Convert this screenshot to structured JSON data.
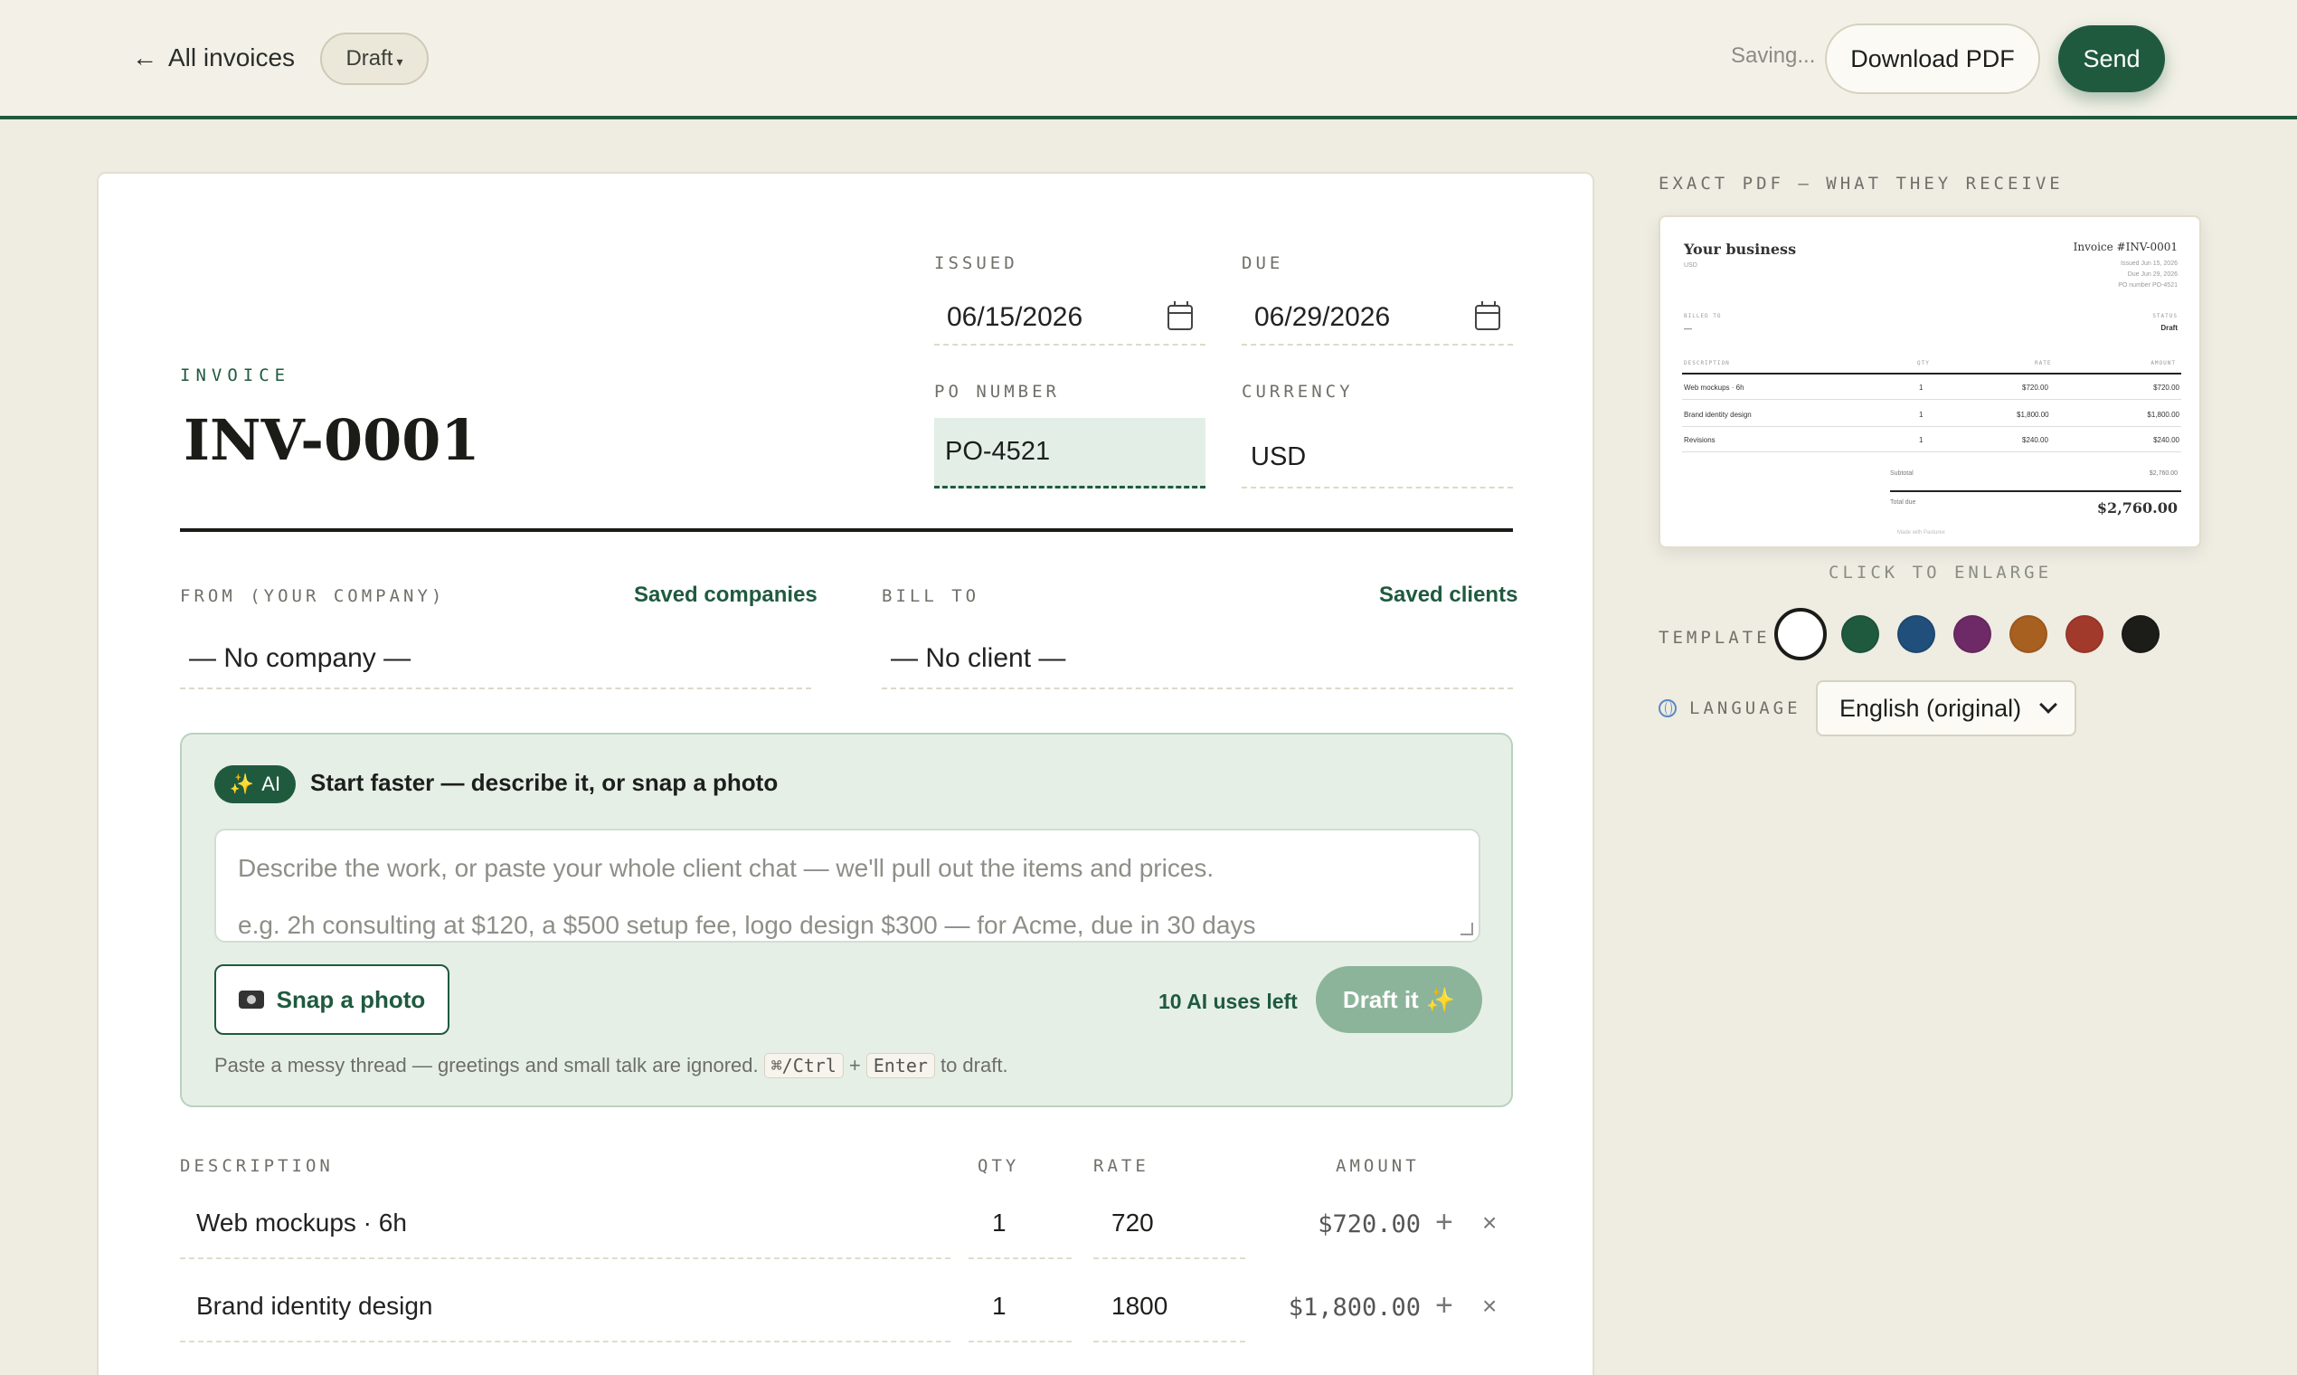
{
  "topbar": {
    "back_label": "All invoices",
    "status_label": "Draft",
    "saving_text": "Saving...",
    "download_label": "Download PDF",
    "send_label": "Send"
  },
  "invoice": {
    "heading": "INVOICE",
    "number": "INV-0001",
    "issued_label": "ISSUED",
    "issued_value": "06/15/2026",
    "due_label": "DUE",
    "due_value": "06/29/2026",
    "po_label": "PO NUMBER",
    "po_value": "PO-4521",
    "currency_label": "CURRENCY",
    "currency_value": "USD"
  },
  "parties": {
    "from_label": "FROM (YOUR COMPANY)",
    "saved_companies": "Saved companies",
    "from_value": "— No company —",
    "bill_to_label": "BILL TO",
    "saved_clients": "Saved clients",
    "bill_to_value": "— No client —"
  },
  "ai": {
    "badge": "AI",
    "title": "Start faster — describe it, or snap a photo",
    "placeholder_line1": "Describe the work, or paste your whole client chat — we'll pull out the items and prices.",
    "placeholder_line2": "e.g. 2h consulting at $120, a $500 setup fee, logo design $300 — for Acme, due in 30 days",
    "snap_label": "Snap a photo",
    "uses_left": "10 AI uses left",
    "draft_label": "Draft it",
    "hint_prefix": "Paste a messy thread — greetings and small talk are ignored.",
    "kbd_mod": "⌘/Ctrl",
    "kbd_plus": "+",
    "kbd_enter": "Enter",
    "hint_suffix": "to draft."
  },
  "items": {
    "headers": {
      "description": "DESCRIPTION",
      "qty": "QTY",
      "rate": "RATE",
      "amount": "AMOUNT"
    },
    "rows": [
      {
        "description": "Web mockups · 6h",
        "qty": "1",
        "rate": "720",
        "amount": "$720.00"
      },
      {
        "description": "Brand identity design",
        "qty": "1",
        "rate": "1800",
        "amount": "$1,800.00"
      }
    ]
  },
  "preview": {
    "label": "EXACT PDF — WHAT THEY RECEIVE",
    "business": "Your business",
    "currency": "USD",
    "invoice_no": "Invoice #INV-0001",
    "issued": "Issued Jun 15, 2026",
    "due": "Due Jun 29, 2026",
    "po": "PO number PO-4521",
    "billed_to_label": "BILLED TO",
    "billed_to_value": "—",
    "status_label": "STATUS",
    "status_value": "Draft",
    "headers": [
      "DESCRIPTION",
      "QTY",
      "RATE",
      "AMOUNT"
    ],
    "rows": [
      [
        "Web mockups · 6h",
        "1",
        "$720.00",
        "$720.00"
      ],
      [
        "Brand identity design",
        "1",
        "$1,800.00",
        "$1,800.00"
      ],
      [
        "Revisions",
        "1",
        "$240.00",
        "$240.00"
      ]
    ],
    "subtotal_label": "Subtotal",
    "subtotal_value": "$2,760.00",
    "total_label": "Total due",
    "total_value": "$2,760.00",
    "footer": "Made with Pasturex",
    "click_to_enlarge": "CLICK TO ENLARGE"
  },
  "template": {
    "label": "TEMPLATE",
    "swatches": [
      "#ffffff",
      "#1f5a3f",
      "#1f4f7a",
      "#6e2a66",
      "#a86020",
      "#a23a2c",
      "#1c1c18"
    ]
  },
  "language": {
    "label": "LANGUAGE",
    "value": "English (original)"
  }
}
